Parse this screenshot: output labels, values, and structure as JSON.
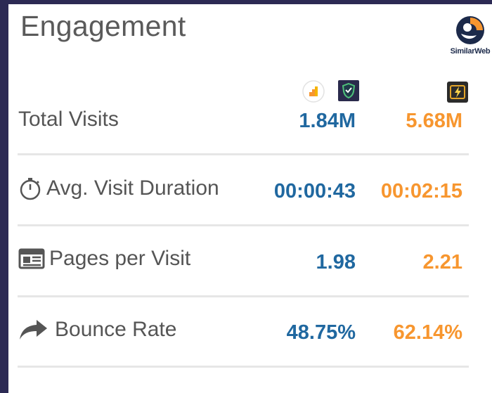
{
  "header": {
    "title": "Engagement",
    "brand": "SimilarWeb"
  },
  "colors": {
    "site1": "#2068a0",
    "site2": "#f7962f",
    "background": "#2c2a54"
  },
  "sites": [
    {
      "icons": [
        "analytics-icon",
        "shield-icon"
      ]
    },
    {
      "icons": [
        "lightning-card-icon"
      ]
    }
  ],
  "metrics": [
    {
      "label": "Total Visits",
      "icon": "",
      "site1": "1.84M",
      "site2": "5.68M"
    },
    {
      "label": "Avg. Visit Duration",
      "icon": "stopwatch-icon",
      "site1": "00:00:43",
      "site2": "00:02:15"
    },
    {
      "label": "Pages per Visit",
      "icon": "pages-icon",
      "site1": "1.98",
      "site2": "2.21"
    },
    {
      "label": "Bounce Rate",
      "icon": "share-arrow-icon",
      "site1": "48.75%",
      "site2": "62.14%"
    }
  ]
}
